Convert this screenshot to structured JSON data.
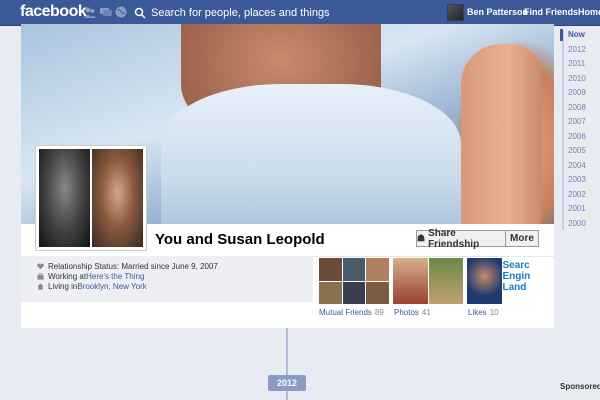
{
  "topbar": {
    "logo": "facebook",
    "search_placeholder": "Search for people, places and things",
    "user_name": "Ben Patterson",
    "find_friends": "Find Friends",
    "home": "Home"
  },
  "profile": {
    "title": "You and Susan Leopold",
    "share_button": "Share Friendship",
    "more_button": "More"
  },
  "info": {
    "relationship": "Relationship Status: Married since June 9, 2007",
    "working_prefix": "Working at ",
    "working_link": "Here's the Thing",
    "living_prefix": "Living in ",
    "living_link": "Brooklyn, New York"
  },
  "tiles": [
    {
      "label": "Mutual Friends",
      "count": "89"
    },
    {
      "label": "Photos",
      "count": "41"
    },
    {
      "label": "Likes",
      "count": "10"
    }
  ],
  "timeline": {
    "years": [
      "Now",
      "2012",
      "2011",
      "2010",
      "2009",
      "2008",
      "2007",
      "2006",
      "2005",
      "2004",
      "2003",
      "2002",
      "2001",
      "2000"
    ],
    "year_marker": "2012"
  },
  "sidebar": {
    "sponsored": "Sponsored"
  },
  "colors": {
    "brand": "#3b5998",
    "link": "#3b5998"
  }
}
